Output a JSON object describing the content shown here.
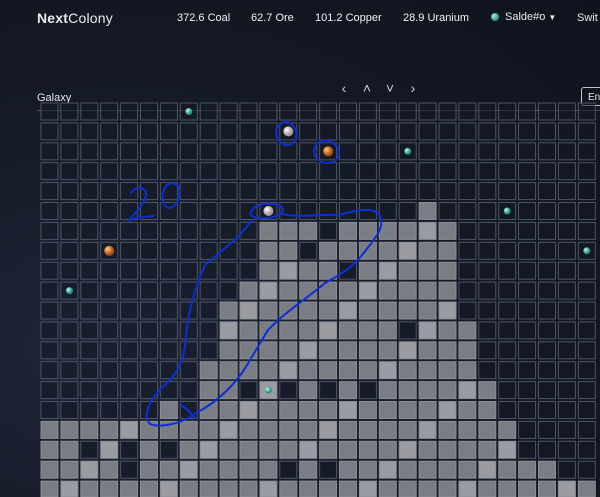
{
  "app": {
    "brand_bold": "Next",
    "brand_rest": "Colony"
  },
  "resources": [
    {
      "label": "372.6 Coal"
    },
    {
      "label": "62.7 Ore"
    },
    {
      "label": "101.2 Copper"
    },
    {
      "label": "28.9 Uranium"
    }
  ],
  "user": {
    "name": "Salde#o",
    "switch_label": "Swit"
  },
  "page": {
    "section": "Galaxy",
    "lang_button": "En"
  },
  "map_nav": {
    "left": "‹",
    "up": "˄",
    "down": "˅",
    "right": "›"
  },
  "colors": {
    "background": "#151a26",
    "cell_border": "#4d5466",
    "explored_cell": "#7a7d84",
    "explored_light": "#9a9ca2",
    "annotation": "#0b2fd6"
  },
  "map": {
    "cols": 28,
    "rows": 20,
    "planets": [
      {
        "type": "teal",
        "col": 7,
        "row": 0
      },
      {
        "type": "white",
        "col": 12,
        "row": 1
      },
      {
        "type": "orange",
        "col": 14,
        "row": 2
      },
      {
        "type": "teal",
        "col": 18,
        "row": 2
      },
      {
        "type": "white",
        "col": 11,
        "row": 5
      },
      {
        "type": "teal",
        "col": 23,
        "row": 5
      },
      {
        "type": "orange",
        "col": 3,
        "row": 7
      },
      {
        "type": "teal",
        "col": 27,
        "row": 7
      },
      {
        "type": "teal",
        "col": 1,
        "row": 9
      },
      {
        "type": "teal",
        "col": 11,
        "row": 14
      }
    ],
    "handwritten_note": "20"
  }
}
